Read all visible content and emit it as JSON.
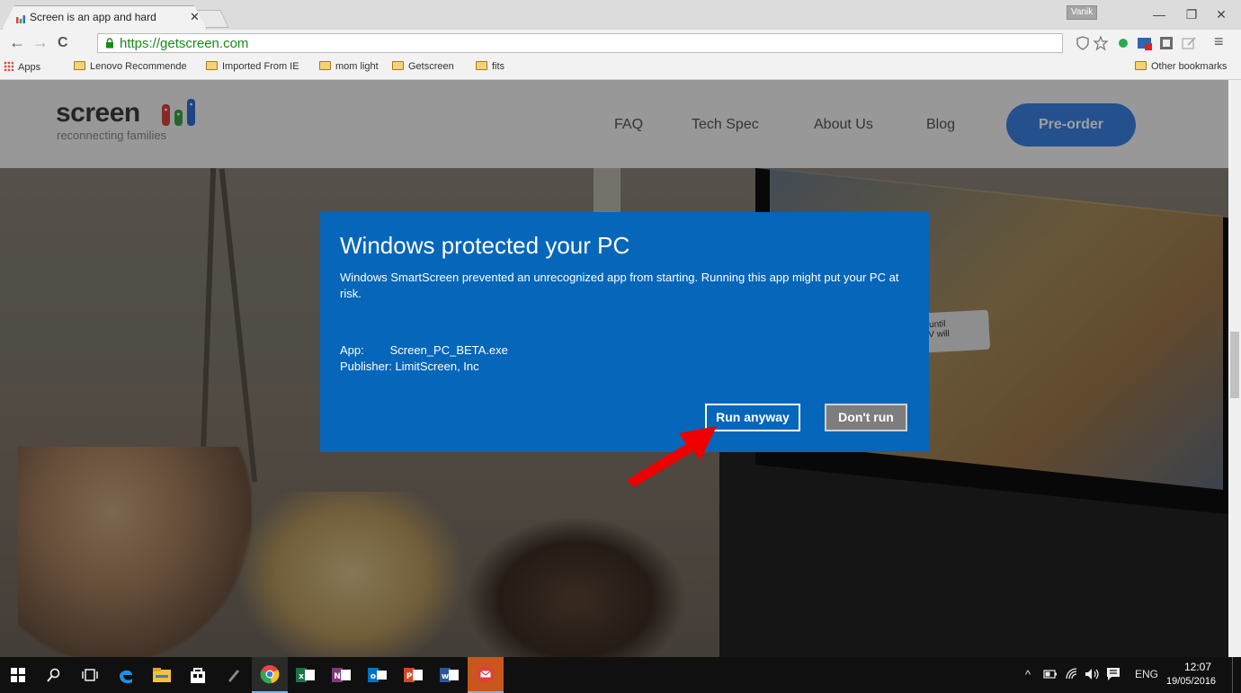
{
  "browser": {
    "tab_title": "Screen is an app and hard",
    "tab_close": "✕",
    "profile_badge": "Vanik",
    "minimize": "—",
    "restore": "❐",
    "close": "✕",
    "back": "←",
    "forward": "→",
    "reload": "C",
    "url": "https://getscreen.com",
    "menu": "≡",
    "bookmarks": [
      "Apps",
      "Lenovo Recommende",
      "Imported From IE",
      "mom light",
      "Getscreen",
      "fits"
    ],
    "other_bookmarks": "Other bookmarks"
  },
  "site": {
    "logo_word": "screen",
    "logo_tagline": "reconnecting families",
    "nav": [
      "FAQ",
      "Tech Spec",
      "About Us",
      "Blog"
    ],
    "preorder_label": "Pre-order",
    "tv_bubble": "les until\ne TV will"
  },
  "dialog": {
    "title": "Windows protected your PC",
    "message": "Windows SmartScreen prevented an unrecognized app from starting. Running this app might put your PC at risk.",
    "app_label": "App:",
    "app_value": "Screen_PC_BETA.exe",
    "publisher_label": "Publisher:",
    "publisher_value": "LimitScreen, Inc",
    "run_anyway_label": "Run anyway",
    "dont_run_label": "Don't run"
  },
  "taskbar": {
    "tray_language": "ENG",
    "clock_time": "12:07",
    "clock_date": "19/05/2016"
  },
  "colors": {
    "dialog_bg": "#0566ba",
    "preorder_bg": "#3b83e6",
    "arrow": "#ee0000"
  }
}
